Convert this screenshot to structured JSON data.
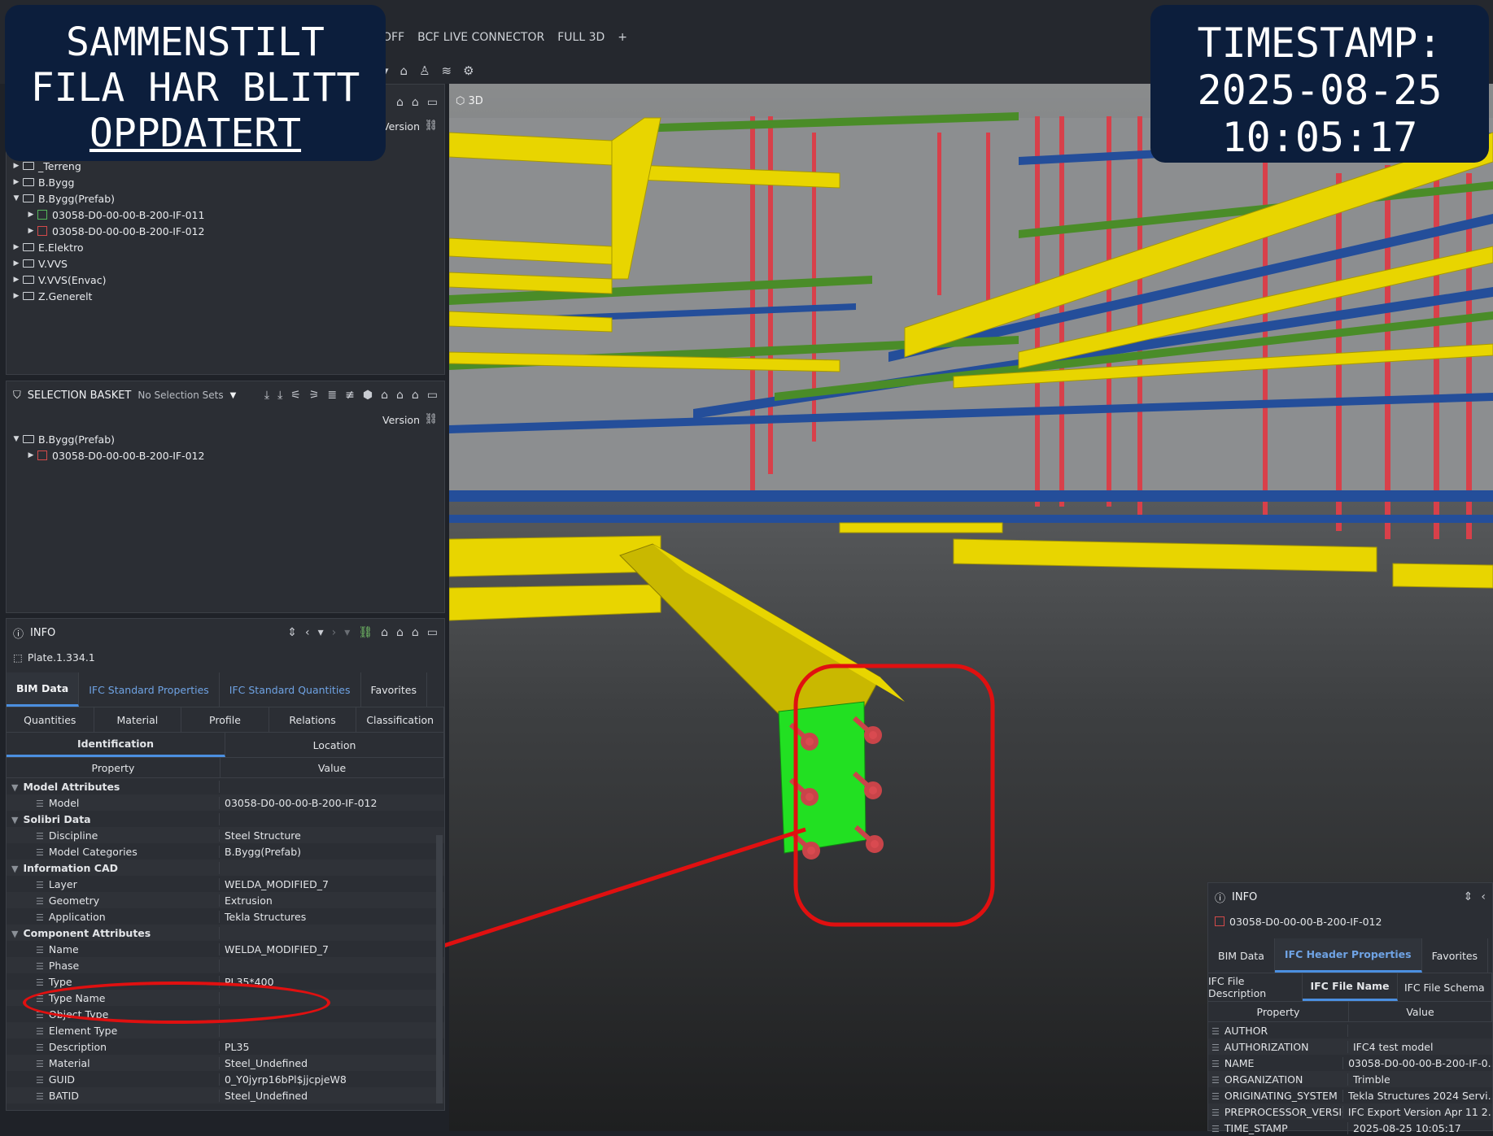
{
  "menu": {
    "items": [
      "OFF",
      "BCF LIVE CONNECTOR",
      "FULL 3D"
    ],
    "add": "+"
  },
  "overlays": {
    "left_line1": "SAMMENSTILT",
    "left_line2": "FILA HAR BLITT",
    "left_line3": "OPPDATERT",
    "right_line1": "TIMESTAMP:",
    "right_line2": "2025-08-25",
    "right_line3": "10:05:17"
  },
  "viewport": {
    "label": "3D"
  },
  "model_tree": {
    "version_label": "Version",
    "items": [
      {
        "label": "_Terreng",
        "type": "folder",
        "level": 0,
        "expanded": false
      },
      {
        "label": "B.Bygg",
        "type": "folder",
        "level": 0,
        "expanded": false
      },
      {
        "label": "B.Bygg(Prefab)",
        "type": "folder",
        "level": 0,
        "expanded": true
      },
      {
        "label": "03058-D0-00-00-B-200-IF-011",
        "type": "ifc-green",
        "level": 1,
        "expanded": false
      },
      {
        "label": "03058-D0-00-00-B-200-IF-012",
        "type": "ifc-red",
        "level": 1,
        "expanded": false
      },
      {
        "label": "E.Elektro",
        "type": "folder",
        "level": 0,
        "expanded": false
      },
      {
        "label": "V.VVS",
        "type": "folder",
        "level": 0,
        "expanded": false
      },
      {
        "label": "V.VVS(Envac)",
        "type": "folder",
        "level": 0,
        "expanded": false
      },
      {
        "label": "Z.Generelt",
        "type": "folder",
        "level": 0,
        "expanded": false
      }
    ]
  },
  "selection_basket": {
    "title": "SELECTION BASKET",
    "sets": "No Selection Sets",
    "version_label": "Version",
    "items": [
      {
        "label": "B.Bygg(Prefab)",
        "type": "folder",
        "level": 0,
        "expanded": true
      },
      {
        "label": "03058-D0-00-00-B-200-IF-012",
        "type": "ifc-red",
        "level": 1,
        "expanded": false
      }
    ]
  },
  "info_left": {
    "title": "INFO",
    "object": "Plate.1.334.1",
    "tabs": [
      "BIM Data",
      "IFC Standard Properties",
      "IFC Standard Quantities",
      "Favorites"
    ],
    "subtabs_row1": [
      "Quantities",
      "Material",
      "Profile",
      "Relations",
      "Classification"
    ],
    "subtabs_row2": [
      "Identification",
      "Location"
    ],
    "col_property": "Property",
    "col_value": "Value",
    "rows": [
      {
        "k": "Model Attributes",
        "v": "",
        "group": true
      },
      {
        "k": "Model",
        "v": "03058-D0-00-00-B-200-IF-012"
      },
      {
        "k": "Solibri Data",
        "v": "",
        "group": true
      },
      {
        "k": "Discipline",
        "v": "Steel Structure"
      },
      {
        "k": "Model Categories",
        "v": "B.Bygg(Prefab)"
      },
      {
        "k": "Information CAD",
        "v": "",
        "group": true
      },
      {
        "k": "Layer",
        "v": "WELDA_MODIFIED_7"
      },
      {
        "k": "Geometry",
        "v": "Extrusion"
      },
      {
        "k": "Application",
        "v": "Tekla Structures"
      },
      {
        "k": "Component Attributes",
        "v": "",
        "group": true
      },
      {
        "k": "Name",
        "v": "WELDA_MODIFIED_7"
      },
      {
        "k": "Phase",
        "v": ""
      },
      {
        "k": "Type",
        "v": "PL35*400"
      },
      {
        "k": "Type Name",
        "v": ""
      },
      {
        "k": "Object Type",
        "v": ""
      },
      {
        "k": "Element Type",
        "v": ""
      },
      {
        "k": "Description",
        "v": "PL35"
      },
      {
        "k": "Material",
        "v": "Steel_Undefined"
      },
      {
        "k": "GUID",
        "v": "0_Y0jyrp16bPl$jjcpjeW8"
      },
      {
        "k": "BATID",
        "v": "Steel_Undefined"
      }
    ]
  },
  "info_right": {
    "title": "INFO",
    "object": "03058-D0-00-00-B-200-IF-012",
    "tabs": [
      "BIM Data",
      "IFC Header Properties",
      "Favorites"
    ],
    "subtabs": [
      "IFC File Description",
      "IFC File Name",
      "IFC File Schema"
    ],
    "col_property": "Property",
    "col_value": "Value",
    "rows": [
      {
        "k": "AUTHOR",
        "v": ""
      },
      {
        "k": "AUTHORIZATION",
        "v": "IFC4 test model"
      },
      {
        "k": "NAME",
        "v": "03058-D0-00-00-B-200-IF-0..."
      },
      {
        "k": "ORGANIZATION",
        "v": "Trimble"
      },
      {
        "k": "ORIGINATING_SYSTEM",
        "v": "Tekla Structures 2024 Servi..."
      },
      {
        "k": "PREPROCESSOR_VERSION",
        "v": "IFC Export Version Apr 11 2..."
      },
      {
        "k": "TIME_STAMP",
        "v": "2025-08-25 10:05:17"
      }
    ]
  },
  "colors": {
    "annotation": "#e01010",
    "beam": "#e8d500",
    "plate": "#22e022",
    "bolt": "#d34a4a",
    "accent": "#4b8fe0"
  }
}
